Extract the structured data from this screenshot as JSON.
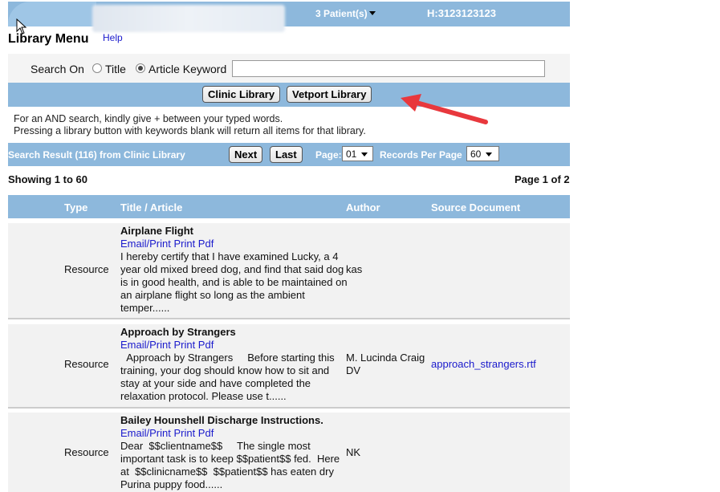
{
  "header": {
    "patients_label": "3 Patient(s)",
    "account_id": "H:3123123123"
  },
  "library": {
    "title": "Library Menu",
    "help_link": "Help"
  },
  "search": {
    "search_on_label": "Search On",
    "option_title": "Title",
    "option_keyword": "Article Keyword",
    "selected_option": "Article Keyword",
    "query_value": "",
    "clinic_button": "Clinic Library",
    "vetport_button": "Vetport Library",
    "help_line_1": "For an AND search, kindly give + between your typed words.",
    "help_line_2": "Pressing a library button with keywords blank will return all items for that library."
  },
  "results": {
    "summary": "Search Result (116) from Clinic Library",
    "next_button": "Next",
    "last_button": "Last",
    "page_label": "Page:",
    "page_value": "01",
    "rpp_label": "Records Per Page",
    "rpp_value": "60",
    "showing": "Showing 1 to 60",
    "page_of": "Page 1 of 2"
  },
  "table": {
    "headers": {
      "type": "Type",
      "title": "Title / Article",
      "author": "Author",
      "source": "Source Document"
    },
    "rows": [
      {
        "type": "Resource",
        "title": "Airplane Flight",
        "links": "Email/Print Print Pdf",
        "description": "I hereby certify that I have examined Lucky, a 4 year old mixed breed dog, and find that said dog is in good health, and is able to be maintained on an airplane flight so long as the ambient temper......",
        "author": "kas",
        "source": ""
      },
      {
        "type": "Resource",
        "title": "Approach by Strangers",
        "links": "Email/Print Print Pdf",
        "description": "  Approach by Strangers     Before starting this training, your dog should know how to sit and stay at your side and have completed the relaxation protocol. Please use t......",
        "author": "M. Lucinda Craig DV",
        "source": "approach_strangers.rtf"
      },
      {
        "type": "Resource",
        "title": "Bailey Hounshell Discharge Instructions.",
        "links": "Email/Print Print Pdf",
        "description": "Dear  $$clientname$$     The single most important task is to keep $$patient$$ fed.  Here at  $$clinicname$$  $$patient$$ has eaten dry Purina puppy food......",
        "author": "NK",
        "source": ""
      }
    ]
  },
  "colors": {
    "bar_blue": "#8db8dc",
    "link_blue": "#1a1acc",
    "annotation_red": "#e8383d"
  }
}
